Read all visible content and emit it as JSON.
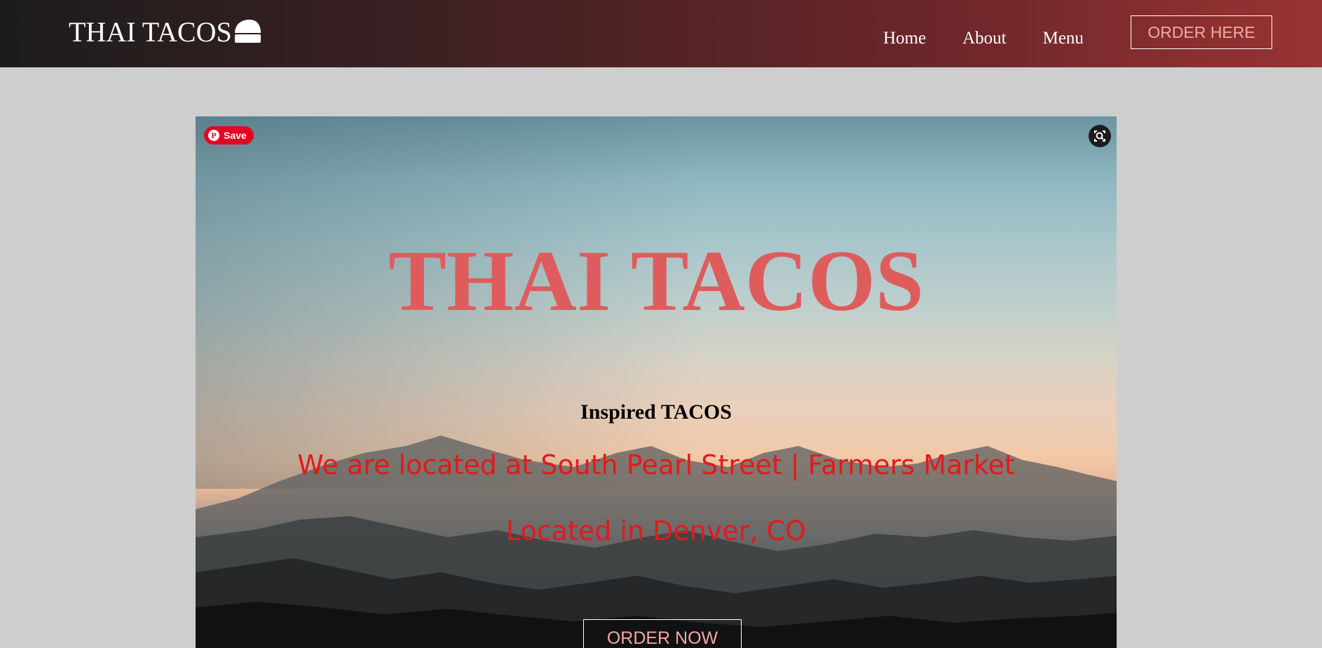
{
  "header": {
    "logo_text": "THAI TACOS",
    "logo_icon": "taco-icon",
    "nav": {
      "home": "Home",
      "about": "About",
      "menu": "Menu"
    },
    "order_button": "ORDER HERE"
  },
  "hero": {
    "title": "THAI TACOS",
    "subtitle": "Inspired TACOS",
    "location_line": "We are located at South Pearl Street | Farmers Market",
    "city_line": "Located in Denver, CO",
    "order_button": "ORDER NOW",
    "pinterest_save": "Save",
    "lens_icon": "visual-search-icon"
  },
  "colors": {
    "header_start": "#1c1c1c",
    "header_end": "#983333",
    "page_bg": "#cececf",
    "title_red": "#df5c5c",
    "text_red": "#e3191b",
    "pinterest_red": "#e60023"
  }
}
